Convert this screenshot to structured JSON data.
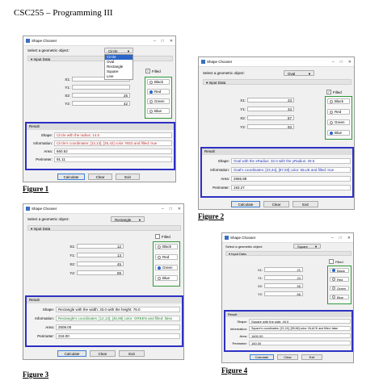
{
  "doc_title": "CSC255 – Programming III",
  "figures": [
    {
      "label": "Figure 1",
      "window_title": "Shape Chooser",
      "prompt": "Select a geometric object:",
      "selected_shape": "Circle",
      "dropdown_items": [
        "Circle",
        "Oval",
        "Rectangle",
        "Square",
        "Line"
      ],
      "section": "Input Data",
      "coords": [
        {
          "label": "X1:",
          "value": ""
        },
        {
          "label": "Y1:",
          "value": ""
        },
        {
          "label": "X2:",
          "value": "25"
        },
        {
          "label": "Y2:",
          "value": "42"
        }
      ],
      "filled_label": "Filled",
      "filled": true,
      "colors": [
        "Black",
        "Red",
        "Green",
        "Blue"
      ],
      "selected_color": "Red",
      "result_title": "Result",
      "shape_label": "Shape:",
      "shape_text": "Circle with the radius: 14.5",
      "info_label": "Information:",
      "info_text": "Circle's coordinates: [12,13], [25,42] color: RED and filled: true",
      "area_label": "Area:",
      "area_text": "660.52",
      "perim_label": "Perimeter:",
      "perim_text": "91.11",
      "buttons": [
        "Calculate",
        "Clear",
        "Exit"
      ]
    },
    {
      "label": "Figure 2",
      "window_title": "Shape Chooser",
      "prompt": "Select a geometric object:",
      "selected_shape": "Oval",
      "section": "Input Data",
      "coords": [
        {
          "label": "X1:",
          "value": "23"
        },
        {
          "label": "Y1:",
          "value": "34"
        },
        {
          "label": "X2:",
          "value": "87"
        },
        {
          "label": "Y2:",
          "value": "93"
        }
      ],
      "filled_label": "Filled",
      "filled": true,
      "colors": [
        "Black",
        "Red",
        "Green",
        "Blue"
      ],
      "selected_color": "Blue",
      "result_title": "Result",
      "shape_label": "Shape:",
      "shape_text": "Oval with the xRadius: 32.0 with the yRadius: 29.5",
      "info_label": "Information:",
      "info_text": "Oval's coordinates: [23,34], [87,93] color: BLUE and filled: true",
      "area_label": "Area:",
      "area_text": "2965.88",
      "perim_label": "Perimeter:",
      "perim_text": "193.27",
      "buttons": [
        "Calculate",
        "Clear",
        "Exit"
      ]
    },
    {
      "label": "Figure 3",
      "window_title": "Shape Chooser",
      "prompt": "Select a geometric object:",
      "selected_shape": "Rectangle",
      "section": "Input Data",
      "coords": [
        {
          "label": "X1:",
          "value": "12"
        },
        {
          "label": "Y1:",
          "value": "13"
        },
        {
          "label": "X2:",
          "value": "45"
        },
        {
          "label": "Y2:",
          "value": "89"
        }
      ],
      "filled_label": "Filled",
      "filled": false,
      "colors": [
        "Black",
        "Red",
        "Green",
        "Blue"
      ],
      "selected_color": "Green",
      "result_title": "Result",
      "shape_label": "Shape:",
      "shape_text": "Rectangle with the width: 33.0 with the height: 76.0",
      "info_label": "Information:",
      "info_text": "Rectangle's coordinates: [12,13], [45,89] color: GREEN and filled: false",
      "area_label": "Area:",
      "area_text": "2508.00",
      "perim_label": "Perimeter:",
      "perim_text": "218.00",
      "buttons": [
        "Calculate",
        "Clear",
        "Exit"
      ]
    },
    {
      "label": "Figure 4",
      "window_title": "Shape Chooser",
      "prompt": "Select a geometric object:",
      "selected_shape": "Square",
      "section": "Input Data",
      "coords": [
        {
          "label": "X1:",
          "value": "21"
        },
        {
          "label": "Y1:",
          "value": "24"
        },
        {
          "label": "X2:",
          "value": "55"
        },
        {
          "label": "Y2:",
          "value": "66"
        }
      ],
      "filled_label": "Filled",
      "filled": false,
      "colors": [
        "Black",
        "Red",
        "Green",
        "Blue"
      ],
      "selected_color": "Black",
      "result_title": "Result",
      "shape_label": "Shape:",
      "shape_text": "Square with the side: 40.0",
      "info_label": "Information:",
      "info_text": "Square's coordinates: [21,24], [55,66] color: BLACK and filled: false",
      "area_label": "Area:",
      "area_text": "1600.00",
      "perim_label": "Perimeter:",
      "perim_text": "160.00",
      "buttons": [
        "Calculate",
        "Clear",
        "Exit"
      ]
    }
  ]
}
